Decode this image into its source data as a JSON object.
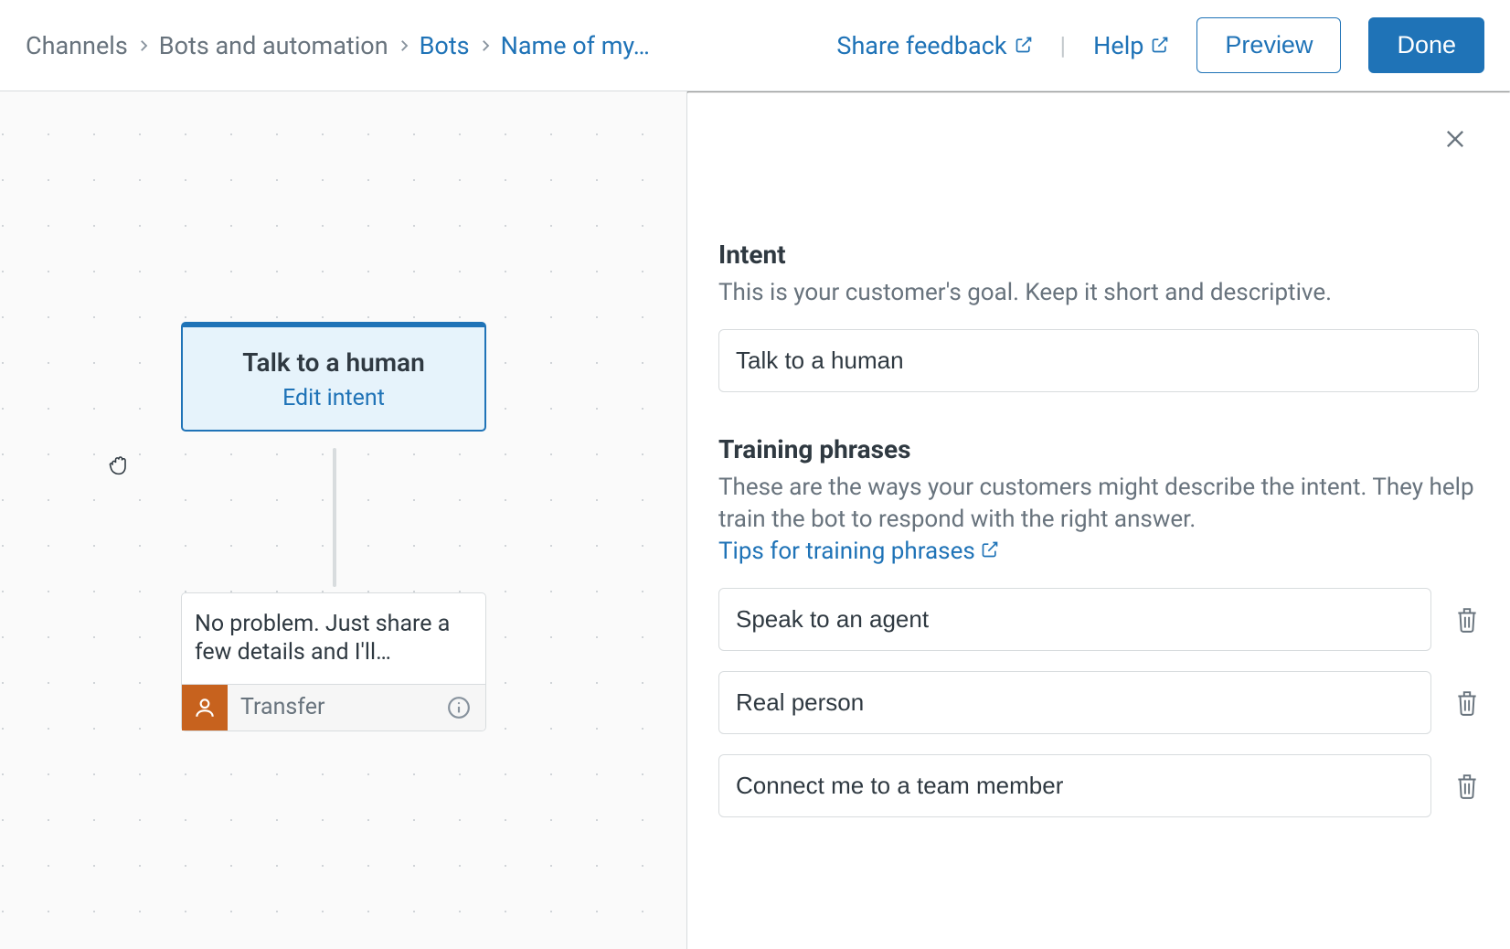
{
  "breadcrumb": {
    "items": [
      "Channels",
      "Bots and automation",
      "Bots",
      "Name of my…"
    ]
  },
  "header": {
    "share_feedback": "Share feedback",
    "help": "Help",
    "preview": "Preview",
    "done": "Done"
  },
  "canvas": {
    "intent_node": {
      "title": "Talk to a human",
      "action": "Edit intent"
    },
    "msg_node": {
      "text": "No problem. Just share a few details and I'll…",
      "footer_label": "Transfer"
    }
  },
  "panel": {
    "intent": {
      "heading": "Intent",
      "description": "This is your customer's goal. Keep it short and descriptive.",
      "value": "Talk to a human"
    },
    "training": {
      "heading": "Training phrases",
      "description": "These are the ways your customers might describe the intent. They help train the bot to respond with the right answer.",
      "tips_link": "Tips for training phrases",
      "phrases": [
        "Speak to an agent",
        "Real person",
        "Connect me to a team member"
      ]
    }
  }
}
